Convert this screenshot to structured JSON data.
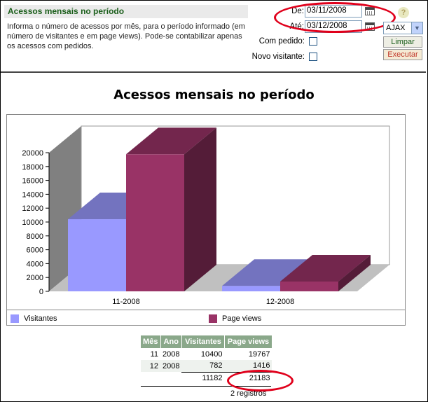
{
  "header": {
    "title": "Acessos mensais no período",
    "description": "Informa o número de acessos por mês, para o período informado (em número de visitantes e em page views). Pode-se contabilizar apenas os acessos com pedidos."
  },
  "filters": {
    "from_label": "De:",
    "from_value": "03/11/2008",
    "to_label": "Até:",
    "to_value": "03/12/2008",
    "com_pedido_label": "Com pedido:",
    "novo_visitante_label": "Novo visitante:",
    "mode_value": "AJAX",
    "clear_label": "Limpar",
    "run_label": "Executar",
    "help_icon": "?"
  },
  "chart_data": {
    "type": "bar",
    "title": "Acessos mensais no período",
    "categories": [
      "11-2008",
      "12-2008"
    ],
    "series": [
      {
        "name": "Visitantes",
        "values": [
          10400,
          782
        ],
        "color": "#9999ff"
      },
      {
        "name": "Page views",
        "values": [
          19767,
          1416
        ],
        "color": "#993366"
      }
    ],
    "ylim": [
      0,
      20000
    ],
    "yticks": [
      "0",
      "2000",
      "4000",
      "6000",
      "8000",
      "10000",
      "12000",
      "14000",
      "16000",
      "18000",
      "20000"
    ],
    "legend": "bottom",
    "grid": false,
    "style": "3d"
  },
  "table": {
    "headers": [
      "Mês",
      "Ano",
      "Visitantes",
      "Page views"
    ],
    "rows": [
      [
        "11",
        "2008",
        "10400",
        "19767"
      ],
      [
        "12",
        "2008",
        "782",
        "1416"
      ]
    ],
    "totals": [
      "",
      "",
      "11182",
      "21183"
    ],
    "footer": "2 registros"
  }
}
